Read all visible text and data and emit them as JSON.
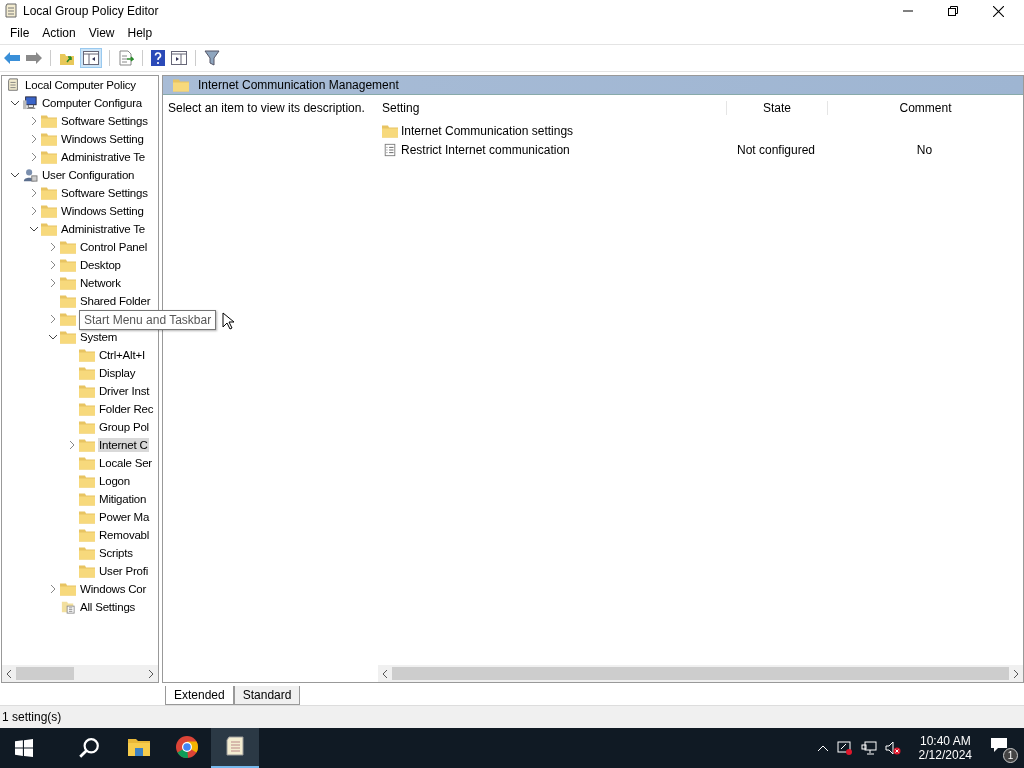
{
  "window": {
    "title": "Local Group Policy Editor"
  },
  "menu": [
    "File",
    "Action",
    "View",
    "Help"
  ],
  "tree": [
    {
      "label": "Local Computer Policy",
      "kind": "policy",
      "selected": false,
      "children": [
        {
          "label": "Computer Configura",
          "kind": "computer",
          "expanded": true,
          "selected": false,
          "children": [
            {
              "label": "Software Settings",
              "kind": "folder",
              "expanded": false,
              "selected": false
            },
            {
              "label": "Windows Setting",
              "kind": "folder",
              "expanded": false,
              "selected": false
            },
            {
              "label": "Administrative Te",
              "kind": "folder",
              "expanded": false,
              "selected": false
            }
          ]
        },
        {
          "label": "User Configuration",
          "kind": "user",
          "expanded": true,
          "selected": false,
          "children": [
            {
              "label": "Software Settings",
              "kind": "folder",
              "expanded": false,
              "selected": false
            },
            {
              "label": "Windows Setting",
              "kind": "folder",
              "expanded": false,
              "selected": false
            },
            {
              "label": "Administrative Te",
              "kind": "folder",
              "expanded": true,
              "selected": false,
              "children": [
                {
                  "label": "Control Panel",
                  "kind": "folder",
                  "expanded": false,
                  "selected": false
                },
                {
                  "label": "Desktop",
                  "kind": "folder",
                  "expanded": false,
                  "selected": false
                },
                {
                  "label": "Network",
                  "kind": "folder",
                  "expanded": false,
                  "selected": false
                },
                {
                  "label": "Shared Folder",
                  "kind": "folder",
                  "selected": false
                },
                {
                  "kind": "folder",
                  "expanded": false,
                  "selected": false
                },
                {
                  "label": "System",
                  "kind": "folder",
                  "expanded": true,
                  "selected": false,
                  "children": [
                    {
                      "label": "Ctrl+Alt+I",
                      "kind": "folder",
                      "selected": false
                    },
                    {
                      "label": "Display",
                      "kind": "folder",
                      "selected": false
                    },
                    {
                      "label": "Driver Inst",
                      "kind": "folder",
                      "selected": false
                    },
                    {
                      "label": "Folder Rec",
                      "kind": "folder",
                      "selected": false
                    },
                    {
                      "label": "Group Pol",
                      "kind": "folder",
                      "selected": false
                    },
                    {
                      "label": "Internet C",
                      "kind": "folder",
                      "expanded": false,
                      "selected": true
                    },
                    {
                      "label": "Locale Ser",
                      "kind": "folder",
                      "selected": false
                    },
                    {
                      "label": "Logon",
                      "kind": "folder",
                      "selected": false
                    },
                    {
                      "label": "Mitigation",
                      "kind": "folder",
                      "selected": false
                    },
                    {
                      "label": "Power Ma",
                      "kind": "folder",
                      "selected": false
                    },
                    {
                      "label": "Removabl",
                      "kind": "folder",
                      "selected": false
                    },
                    {
                      "label": "Scripts",
                      "kind": "folder",
                      "selected": false
                    },
                    {
                      "label": "User Profi",
                      "kind": "folder",
                      "selected": false
                    }
                  ]
                },
                {
                  "label": "Windows Cor",
                  "kind": "folder",
                  "expanded": false,
                  "selected": false
                },
                {
                  "label": "All Settings",
                  "kind": "settings",
                  "selected": false
                }
              ]
            }
          ]
        }
      ]
    }
  ],
  "tooltip": "Start Menu and Taskbar",
  "panel": {
    "title": "Internet Communication Management",
    "description": "Select an item to view its description."
  },
  "table": {
    "columns": [
      "Setting",
      "State",
      "Comment"
    ],
    "rows": [
      {
        "kind": "folder",
        "setting": "Internet Communication settings"
      },
      {
        "kind": "setting",
        "setting": "Restrict Internet communication",
        "state": "Not configured",
        "comment": "No"
      }
    ]
  },
  "tabs": [
    {
      "label": "Extended",
      "selected": true
    },
    {
      "label": "Standard",
      "selected": false
    }
  ],
  "status_bar": "1 setting(s)",
  "taskbar": {
    "apps": [
      {
        "kind": "explorer",
        "active": false
      },
      {
        "kind": "chrome",
        "active": false
      },
      {
        "kind": "gpedit",
        "active": true
      }
    ],
    "time": "10:40 AM",
    "date": "2/12/2024",
    "notifications": "1"
  }
}
